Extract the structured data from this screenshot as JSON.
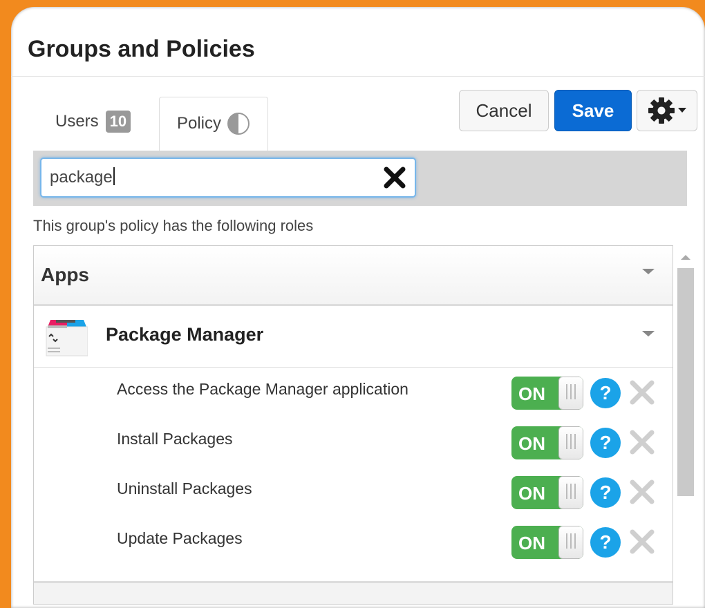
{
  "dialog": {
    "title": "Groups and Policies"
  },
  "tabs": {
    "users": {
      "label": "Users",
      "count": "10"
    },
    "policy": {
      "label": "Policy"
    }
  },
  "toolbar": {
    "cancel_label": "Cancel",
    "save_label": "Save",
    "settings_icon": "gear-icon"
  },
  "search": {
    "value": "package"
  },
  "roles_caption": "This group's policy has the following roles",
  "section": {
    "title": "Apps",
    "app": {
      "title": "Package Manager",
      "roles": [
        {
          "label": "Access the Package Manager application",
          "state": "ON"
        },
        {
          "label": "Install Packages",
          "state": "ON"
        },
        {
          "label": "Uninstall Packages",
          "state": "ON"
        },
        {
          "label": "Update Packages",
          "state": "ON"
        }
      ]
    }
  },
  "colors": {
    "frame": "#f28a1e",
    "save": "#0b6bd4",
    "toggle_on": "#4caf50",
    "help": "#1ba3e8"
  }
}
